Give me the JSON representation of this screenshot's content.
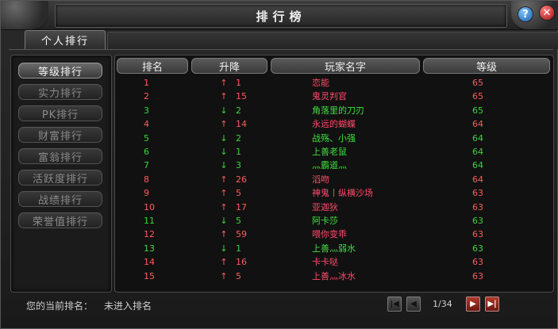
{
  "window": {
    "title": "排行榜"
  },
  "tabs": [
    {
      "label": "个人排行"
    }
  ],
  "categories": [
    {
      "label": "等级排行",
      "active": true
    },
    {
      "label": "实力排行",
      "active": false
    },
    {
      "label": "PK排行",
      "active": false
    },
    {
      "label": "财富排行",
      "active": false
    },
    {
      "label": "富翁排行",
      "active": false
    },
    {
      "label": "活跃度排行",
      "active": false
    },
    {
      "label": "战绩排行",
      "active": false
    },
    {
      "label": "荣誉值排行",
      "active": false
    }
  ],
  "table": {
    "headers": [
      "排名",
      "升降",
      "玩家名字",
      "等级"
    ],
    "rows": [
      {
        "rank": "1",
        "dir": "up",
        "arrow": "↑",
        "change": "1",
        "name": "恋能",
        "level": "65"
      },
      {
        "rank": "2",
        "dir": "up",
        "arrow": "↑",
        "change": "15",
        "name": "鬼灵判官",
        "level": "65"
      },
      {
        "rank": "3",
        "dir": "down",
        "arrow": "↓",
        "change": "2",
        "name": "角落里的刀刃",
        "level": "65"
      },
      {
        "rank": "4",
        "dir": "up",
        "arrow": "↑",
        "change": "14",
        "name": "永远的蝴蝶",
        "level": "64"
      },
      {
        "rank": "5",
        "dir": "down",
        "arrow": "↓",
        "change": "2",
        "name": "战殇、小强",
        "level": "64"
      },
      {
        "rank": "6",
        "dir": "down",
        "arrow": "↓",
        "change": "1",
        "name": "上善老鼠",
        "level": "64"
      },
      {
        "rank": "7",
        "dir": "down",
        "arrow": "↓",
        "change": "3",
        "name": "灬霸道灬",
        "level": "64"
      },
      {
        "rank": "8",
        "dir": "up",
        "arrow": "↑",
        "change": "26",
        "name": "滔吻",
        "level": "64"
      },
      {
        "rank": "9",
        "dir": "up",
        "arrow": "↑",
        "change": "5",
        "name": "神鬼丨纵横沙场",
        "level": "63"
      },
      {
        "rank": "10",
        "dir": "up",
        "arrow": "↑",
        "change": "17",
        "name": "亚迦狄",
        "level": "63"
      },
      {
        "rank": "11",
        "dir": "down",
        "arrow": "↓",
        "change": "5",
        "name": "阿卡莎",
        "level": "63"
      },
      {
        "rank": "12",
        "dir": "up",
        "arrow": "↑",
        "change": "59",
        "name": "喂你变乖",
        "level": "63"
      },
      {
        "rank": "13",
        "dir": "down",
        "arrow": "↓",
        "change": "1",
        "name": "上善灬弱水",
        "level": "63"
      },
      {
        "rank": "14",
        "dir": "up",
        "arrow": "↑",
        "change": "16",
        "name": "卡卡哒",
        "level": "63"
      },
      {
        "rank": "15",
        "dir": "up",
        "arrow": "↑",
        "change": "5",
        "name": "上善灬冰水",
        "level": "63"
      }
    ]
  },
  "footer": {
    "current_rank_label": "您的当前排名：",
    "current_rank_value": "未进入排名",
    "page": "1/34"
  },
  "colors": {
    "up": "#ff5a5a",
    "down": "#39d63a",
    "up_name": "#ff4a6a",
    "down_name": "#3ee03e"
  },
  "icons": {
    "help": "question-icon",
    "close": "close-icon",
    "first": "first-page-icon",
    "prev": "prev-page-icon",
    "next": "next-page-icon",
    "last": "last-page-icon"
  }
}
